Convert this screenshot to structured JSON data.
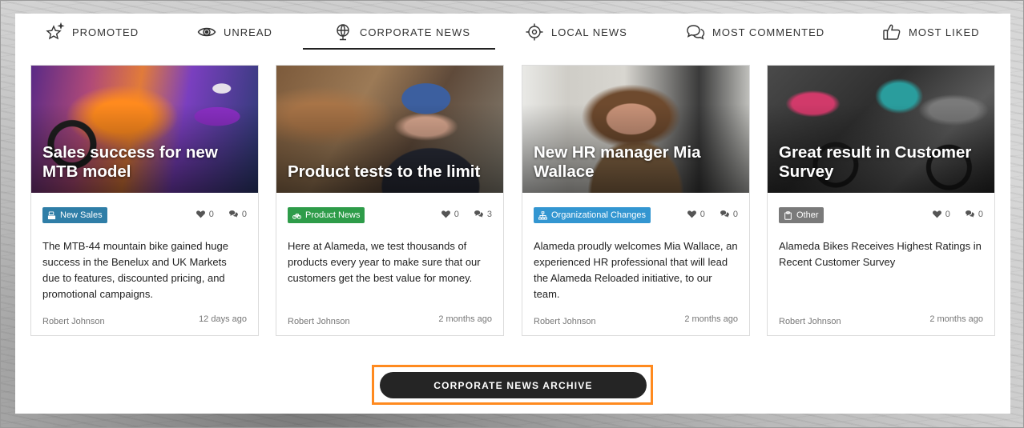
{
  "tabs": [
    {
      "label": "PROMOTED",
      "icon": "sparkle-star-icon"
    },
    {
      "label": "UNREAD",
      "icon": "eye-icon"
    },
    {
      "label": "CORPORATE NEWS",
      "icon": "globe-icon"
    },
    {
      "label": "LOCAL NEWS",
      "icon": "location-target-icon"
    },
    {
      "label": "MOST COMMENTED",
      "icon": "chat-bubbles-icon"
    },
    {
      "label": "MOST LIKED",
      "icon": "thumbs-up-icon"
    }
  ],
  "active_tab": "CORPORATE NEWS",
  "cards": [
    {
      "title": "Sales success for new MTB model",
      "category": "New Sales",
      "category_color": "#2f7ea7",
      "category_icon": "cash-register-icon",
      "likes": "0",
      "comments": "0",
      "description": "The MTB-44 mountain bike gained huge success in the Benelux and UK Markets due to features, discounted pricing, and promotional campaigns.",
      "author": "Robert Johnson",
      "time_ago": "12 days ago"
    },
    {
      "title": "Product tests to the limit",
      "category": "Product News",
      "category_color": "#2e9c49",
      "category_icon": "bicycle-icon",
      "likes": "0",
      "comments": "3",
      "description": "Here at Alameda, we test thousands of products every year to make sure that our customers get the best value for money.",
      "author": "Robert Johnson",
      "time_ago": "2 months ago"
    },
    {
      "title": "New HR manager Mia Wallace",
      "category": "Organizational Changes",
      "category_color": "#3396d1",
      "category_icon": "org-chart-icon",
      "likes": "0",
      "comments": "0",
      "description": "Alameda proudly welcomes Mia Wallace, an experienced HR professional that will lead the Alameda Reloaded initiative, to our team.",
      "author": "Robert Johnson",
      "time_ago": "2 months ago"
    },
    {
      "title": "Great result in Customer Survey",
      "category": "Other",
      "category_color": "#7a7a7a",
      "category_icon": "clipboard-icon",
      "likes": "0",
      "comments": "0",
      "description": "Alameda Bikes Receives Highest Ratings in Recent Customer Survey",
      "author": "Robert Johnson",
      "time_ago": "2 months ago"
    }
  ],
  "archive_button": "CORPORATE NEWS ARCHIVE"
}
